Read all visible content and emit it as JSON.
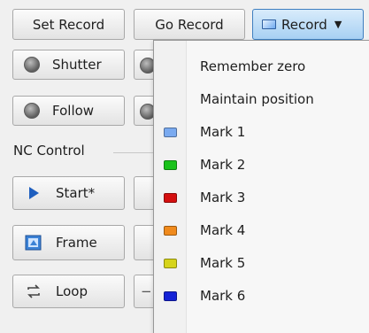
{
  "toolbar": {
    "set_record": "Set Record",
    "go_record": "Go Record",
    "record": "Record"
  },
  "buttons": {
    "shutter": "Shutter",
    "follow": "Follow",
    "start": "Start*",
    "frame": "Frame",
    "loop": "Loop"
  },
  "section": {
    "nc_control": "NC Control"
  },
  "menu": {
    "items": [
      {
        "label": "Remember zero"
      },
      {
        "label": "Maintain position"
      },
      {
        "label": "Mark 1",
        "color": "#7aaaf0"
      },
      {
        "label": "Mark 2",
        "color": "#19c21a"
      },
      {
        "label": "Mark 3",
        "color": "#d40f0f"
      },
      {
        "label": "Mark 4",
        "color": "#f08a1c"
      },
      {
        "label": "Mark 5",
        "color": "#d6d41a"
      },
      {
        "label": "Mark 6",
        "color": "#1422d6"
      }
    ]
  },
  "colors": {
    "record_accent": "#3f7fc0",
    "start_arrow": "#1f5fbf"
  }
}
